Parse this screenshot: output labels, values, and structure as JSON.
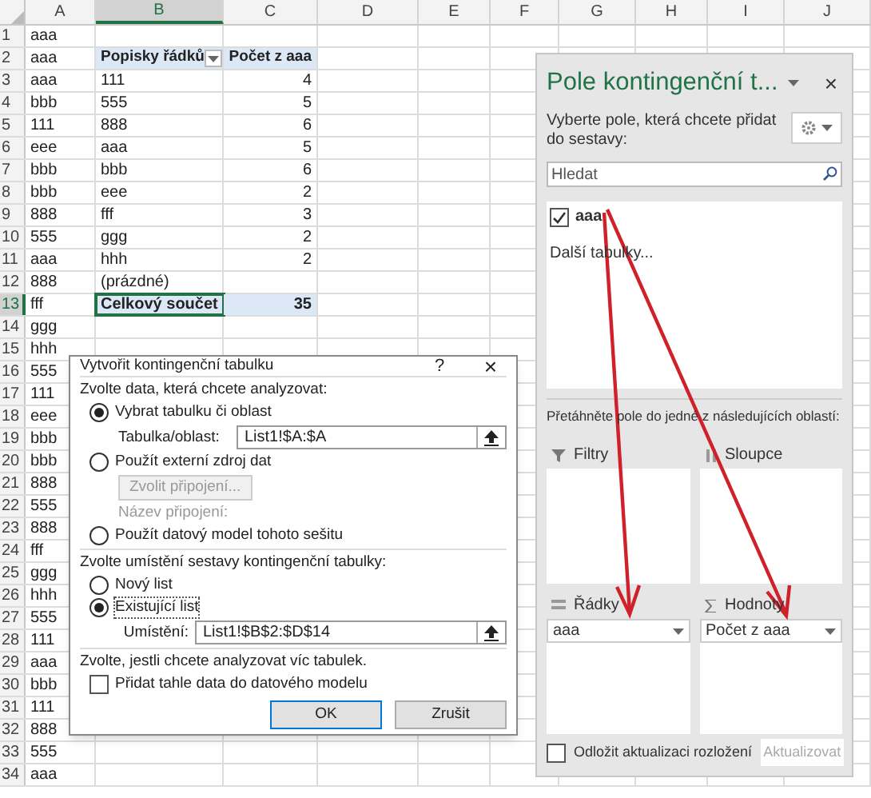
{
  "sheet": {
    "columns": [
      {
        "label": "A",
        "selected": false
      },
      {
        "label": "B",
        "selected": true
      },
      {
        "label": "C",
        "selected": false
      },
      {
        "label": "D",
        "selected": false
      },
      {
        "label": "E",
        "selected": false
      },
      {
        "label": "F",
        "selected": false
      },
      {
        "label": "G",
        "selected": false
      },
      {
        "label": "H",
        "selected": false
      },
      {
        "label": "I",
        "selected": false
      },
      {
        "label": "J",
        "selected": false
      }
    ],
    "rows": [
      {
        "number": "1",
        "selected": false,
        "a": "aaa"
      },
      {
        "number": "2",
        "selected": false,
        "a": "aaa"
      },
      {
        "number": "3",
        "selected": false,
        "a": "aaa"
      },
      {
        "number": "4",
        "selected": false,
        "a": "bbb"
      },
      {
        "number": "5",
        "selected": false,
        "a": "111"
      },
      {
        "number": "6",
        "selected": false,
        "a": "eee"
      },
      {
        "number": "7",
        "selected": false,
        "a": "bbb"
      },
      {
        "number": "8",
        "selected": false,
        "a": "bbb"
      },
      {
        "number": "9",
        "selected": false,
        "a": "888"
      },
      {
        "number": "10",
        "selected": false,
        "a": "555"
      },
      {
        "number": "11",
        "selected": false,
        "a": "aaa"
      },
      {
        "number": "12",
        "selected": false,
        "a": "888"
      },
      {
        "number": "13",
        "selected": true,
        "a": "fff"
      },
      {
        "number": "14",
        "selected": false,
        "a": "ggg"
      },
      {
        "number": "15",
        "selected": false,
        "a": "hhh"
      },
      {
        "number": "16",
        "selected": false,
        "a": "555"
      },
      {
        "number": "17",
        "selected": false,
        "a": "111"
      },
      {
        "number": "18",
        "selected": false,
        "a": "eee"
      },
      {
        "number": "19",
        "selected": false,
        "a": "bbb"
      },
      {
        "number": "20",
        "selected": false,
        "a": "bbb"
      },
      {
        "number": "21",
        "selected": false,
        "a": "888"
      },
      {
        "number": "22",
        "selected": false,
        "a": "555"
      },
      {
        "number": "23",
        "selected": false,
        "a": "888"
      },
      {
        "number": "24",
        "selected": false,
        "a": "fff"
      },
      {
        "number": "25",
        "selected": false,
        "a": "ggg"
      },
      {
        "number": "26",
        "selected": false,
        "a": "hhh"
      },
      {
        "number": "27",
        "selected": false,
        "a": "555"
      },
      {
        "number": "28",
        "selected": false,
        "a": "111"
      },
      {
        "number": "29",
        "selected": false,
        "a": "aaa"
      },
      {
        "number": "30",
        "selected": false,
        "a": "bbb"
      },
      {
        "number": "31",
        "selected": false,
        "a": "111"
      },
      {
        "number": "32",
        "selected": false,
        "a": "888"
      },
      {
        "number": "33",
        "selected": false,
        "a": "555"
      },
      {
        "number": "34",
        "selected": false,
        "a": "aaa"
      }
    ]
  },
  "pivot": {
    "header_label": "Popisky řádků",
    "header_value": "Počet z aaa",
    "items": [
      {
        "label": "111",
        "value": "4"
      },
      {
        "label": "555",
        "value": "5"
      },
      {
        "label": "888",
        "value": "6"
      },
      {
        "label": "aaa",
        "value": "5"
      },
      {
        "label": "bbb",
        "value": "6"
      },
      {
        "label": "eee",
        "value": "2"
      },
      {
        "label": "fff",
        "value": "3"
      },
      {
        "label": "ggg",
        "value": "2"
      },
      {
        "label": "hhh",
        "value": "2"
      },
      {
        "label": "(prázdné)"
      }
    ],
    "total": {
      "label": "Celkový součet",
      "value": "35",
      "selected": true
    }
  },
  "dialog": {
    "title": "Vytvořit kontingenční tabulku",
    "help": "?",
    "close": "×",
    "data_section": "Zvolte data, která chcete analyzovat:",
    "data_options": [
      {
        "label": "Vybrat tabulku či oblast",
        "selected": true
      },
      {
        "label": "Použít externí zdroj dat",
        "selected": false
      },
      {
        "label": "Použít datový model tohoto sešitu",
        "selected": false
      }
    ],
    "range_label": "Tabulka/oblast:",
    "range_value": "List1!$A:$A",
    "connection_button": {
      "label": "Zvolit připojení...",
      "disabled": true
    },
    "connection_name_label": "Název připojení:",
    "place_section": "Zvolte umístění sestavy kontingenční tabulky:",
    "place_options": [
      {
        "label": "Nový list",
        "selected": false
      },
      {
        "label": "Existující list",
        "selected": true
      }
    ],
    "location_label": "Umístění:",
    "location_value": "List1!$B$2:$D$14",
    "multi_section": "Zvolte, jestli chcete analyzovat víc tabulek.",
    "model_checkbox": {
      "label": "Přidat tahle data do datového modelu",
      "checked": false
    },
    "buttons": [
      "OK",
      "Zrušit"
    ]
  },
  "pane": {
    "title": "Pole kontingenční t...",
    "close": "×",
    "instruction": "Vyberte pole, která chcete přidat do sestavy:",
    "search": {
      "placeholder": "Hledat"
    },
    "fields": [
      {
        "label": "aaa",
        "checked": true
      }
    ],
    "more_tables": "Další tabulky...",
    "drag_hint": "Přetáhněte pole do jedné z následujících oblastí:",
    "areas": [
      {
        "kind": "filter",
        "label": "Filtry"
      },
      {
        "kind": "columns",
        "label": "Sloupce"
      },
      {
        "kind": "rows",
        "label": "Řádky",
        "items": [
          "aaa"
        ]
      },
      {
        "kind": "values",
        "label": "Hodnoty",
        "items": [
          "Počet z aaa"
        ]
      }
    ],
    "defer": {
      "label": "Odložit aktualizaci rozložení",
      "checked": false
    },
    "update_button": {
      "label": "Aktualizovat",
      "disabled": true
    }
  }
}
